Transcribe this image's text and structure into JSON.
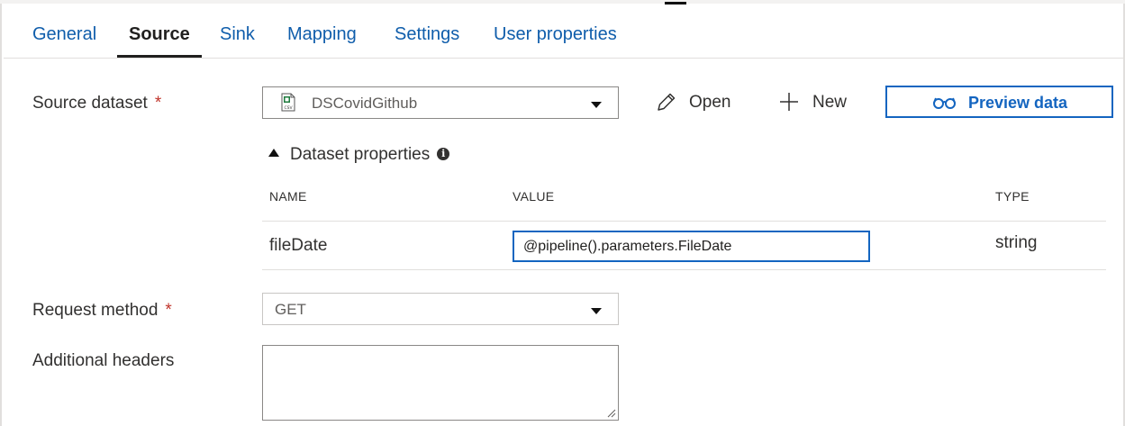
{
  "tabs": [
    {
      "label": "General",
      "active": false
    },
    {
      "label": "Source",
      "active": true
    },
    {
      "label": "Sink",
      "active": false
    },
    {
      "label": "Mapping",
      "active": false
    },
    {
      "label": "Settings",
      "active": false
    },
    {
      "label": "User properties",
      "active": false
    }
  ],
  "source_dataset": {
    "label": "Source dataset",
    "required_mark": "*",
    "value": "DSCovidGithub",
    "icon": "csv-file-icon"
  },
  "actions": {
    "open_label": "Open",
    "new_label": "New",
    "preview_label": "Preview data"
  },
  "dataset_properties": {
    "title": "Dataset properties",
    "headers": {
      "name": "NAME",
      "value": "VALUE",
      "type": "TYPE"
    },
    "rows": [
      {
        "name": "fileDate",
        "value": "@pipeline().parameters.FileDate",
        "type": "string"
      }
    ]
  },
  "request_method": {
    "label": "Request method",
    "required_mark": "*",
    "value": "GET"
  },
  "additional_headers": {
    "label": "Additional headers",
    "value": ""
  },
  "colors": {
    "accent": "#1465c0",
    "tab_text": "#0f5dab",
    "required": "#c0352c"
  }
}
